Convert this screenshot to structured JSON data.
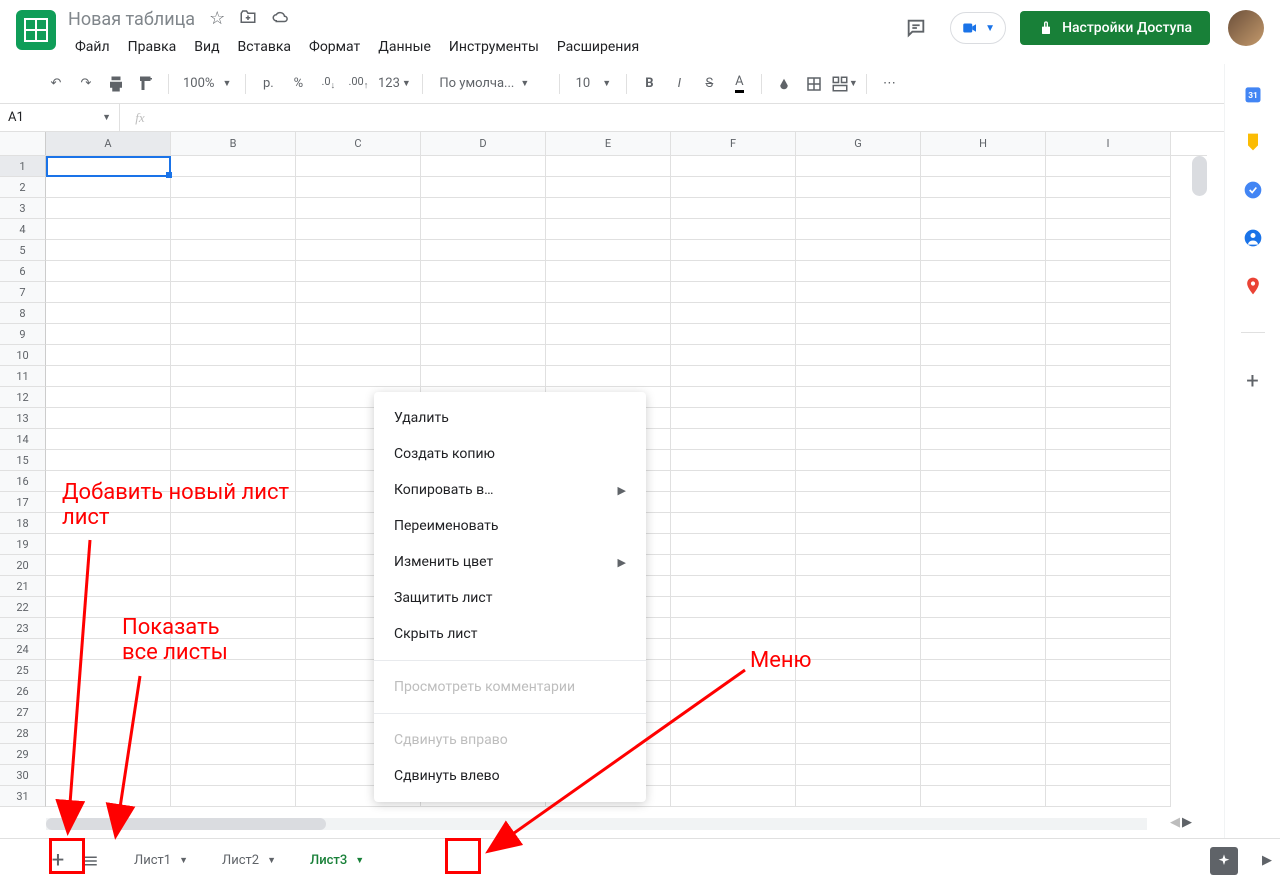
{
  "doc": {
    "title": "Новая таблица"
  },
  "menubar": [
    "Файл",
    "Правка",
    "Вид",
    "Вставка",
    "Формат",
    "Данные",
    "Инструменты",
    "Расширения"
  ],
  "share_label": "Настройки Доступа",
  "toolbar": {
    "zoom": "100%",
    "currency": "р.",
    "percent": "%",
    "dec_dec": ".0",
    "inc_dec": ".00",
    "num123": "123",
    "font": "По умолча...",
    "font_size": "10"
  },
  "namebox": "A1",
  "columns": [
    "A",
    "B",
    "C",
    "D",
    "E",
    "F",
    "G",
    "H",
    "I"
  ],
  "row_count": 31,
  "sheets": [
    "Лист1",
    "Лист2",
    "Лист3"
  ],
  "active_sheet_index": 2,
  "context_menu": [
    {
      "label": "Удалить",
      "type": "item"
    },
    {
      "label": "Создать копию",
      "type": "item"
    },
    {
      "label": "Копировать в…",
      "type": "submenu"
    },
    {
      "label": "Переименовать",
      "type": "item"
    },
    {
      "label": "Изменить цвет",
      "type": "submenu"
    },
    {
      "label": "Защитить лист",
      "type": "item"
    },
    {
      "label": "Скрыть лист",
      "type": "item"
    },
    {
      "type": "sep"
    },
    {
      "label": "Просмотреть комментарии",
      "type": "disabled"
    },
    {
      "type": "sep"
    },
    {
      "label": "Сдвинуть вправо",
      "type": "disabled"
    },
    {
      "label": "Сдвинуть влево",
      "type": "item"
    }
  ],
  "annotations": {
    "add_sheet": "Добавить новый лист",
    "all_sheets": "Показать все листы",
    "menu": "Меню"
  },
  "side_calendar_day": "31"
}
